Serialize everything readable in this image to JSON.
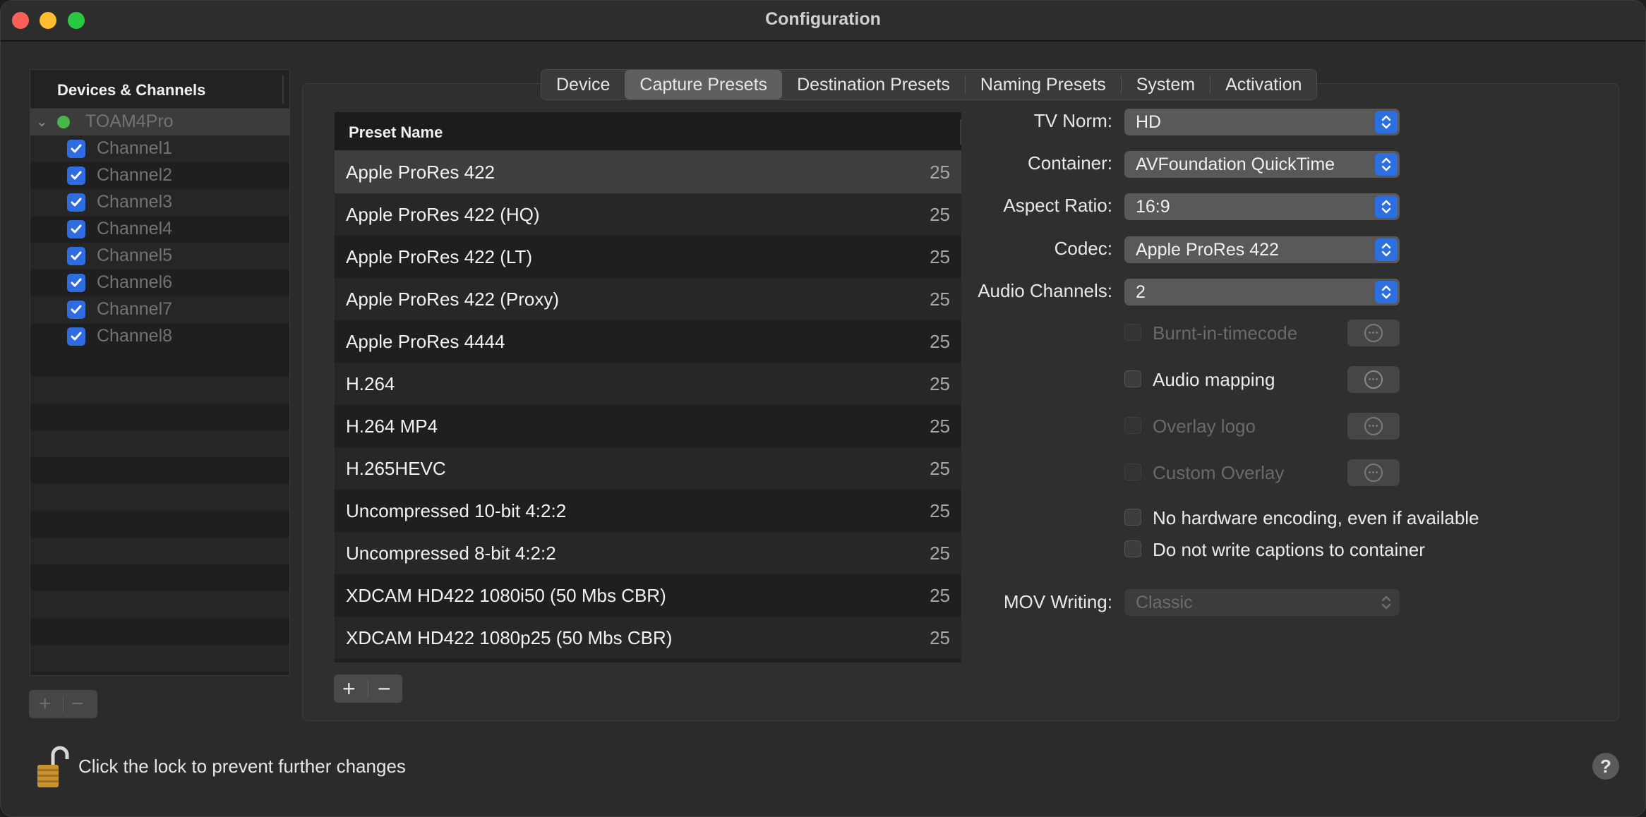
{
  "window": {
    "title": "Configuration"
  },
  "sidebar": {
    "header": "Devices & Channels",
    "device": {
      "name": "TOAM4Pro",
      "status_color": "#48b648"
    },
    "channels": [
      {
        "label": "Channel1",
        "checked": true
      },
      {
        "label": "Channel2",
        "checked": true
      },
      {
        "label": "Channel3",
        "checked": true
      },
      {
        "label": "Channel4",
        "checked": true
      },
      {
        "label": "Channel5",
        "checked": true
      },
      {
        "label": "Channel6",
        "checked": true
      },
      {
        "label": "Channel7",
        "checked": true
      },
      {
        "label": "Channel8",
        "checked": true
      }
    ],
    "add_label": "+",
    "remove_label": "−"
  },
  "tabs": [
    {
      "label": "Device"
    },
    {
      "label": "Capture Presets",
      "active": true
    },
    {
      "label": "Destination Presets"
    },
    {
      "label": "Naming Presets"
    },
    {
      "label": "System"
    },
    {
      "label": "Activation"
    }
  ],
  "presets": {
    "column_header": "Preset Name",
    "rows": [
      {
        "name": "Apple ProRes 422",
        "fps": "25"
      },
      {
        "name": "Apple ProRes 422 (HQ)",
        "fps": "25"
      },
      {
        "name": "Apple ProRes 422 (LT)",
        "fps": "25"
      },
      {
        "name": "Apple ProRes 422 (Proxy)",
        "fps": "25"
      },
      {
        "name": "Apple ProRes 4444",
        "fps": "25"
      },
      {
        "name": "H.264",
        "fps": "25"
      },
      {
        "name": "H.264 MP4",
        "fps": "25"
      },
      {
        "name": "H.265HEVC",
        "fps": "25"
      },
      {
        "name": "Uncompressed 10-bit 4:2:2",
        "fps": "25"
      },
      {
        "name": "Uncompressed 8-bit 4:2:2",
        "fps": "25"
      },
      {
        "name": "XDCAM HD422 1080i50 (50 Mbs CBR)",
        "fps": "25"
      },
      {
        "name": "XDCAM HD422 1080p25 (50 Mbs CBR)",
        "fps": "25"
      }
    ],
    "add_label": "+",
    "remove_label": "−"
  },
  "settings": {
    "tv_norm": {
      "label": "TV Norm:",
      "value": "HD"
    },
    "container": {
      "label": "Container:",
      "value": "AVFoundation QuickTime"
    },
    "aspect_ratio": {
      "label": "Aspect Ratio:",
      "value": "16:9"
    },
    "codec": {
      "label": "Codec:",
      "value": "Apple ProRes 422"
    },
    "audio_channels": {
      "label": "Audio Channels:",
      "value": "2"
    },
    "burnt_in_timecode": {
      "label": "Burnt-in-timecode",
      "checked": false,
      "enabled": false
    },
    "audio_mapping": {
      "label": "Audio mapping",
      "checked": false,
      "enabled": true
    },
    "overlay_logo": {
      "label": "Overlay logo",
      "checked": false,
      "enabled": false
    },
    "custom_overlay": {
      "label": "Custom Overlay",
      "checked": false,
      "enabled": false
    },
    "no_hw_encoding": {
      "label": "No hardware encoding, even if available",
      "checked": false
    },
    "no_captions": {
      "label": "Do not write captions to container",
      "checked": false
    },
    "mov_writing": {
      "label": "MOV Writing:",
      "value": "Classic",
      "enabled": false
    }
  },
  "footer": {
    "lock_text": "Click the lock to prevent further changes",
    "help_label": "?"
  },
  "colors": {
    "accent": "#2c6fe0",
    "checkbox": "#2e6ce0"
  }
}
